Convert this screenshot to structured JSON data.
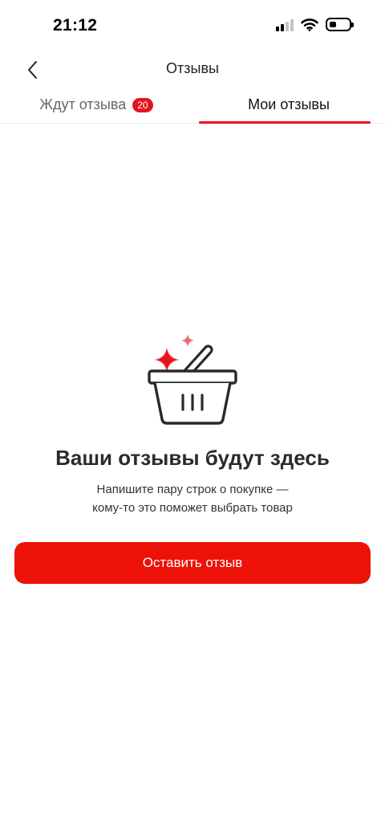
{
  "status_bar": {
    "time": "21:12",
    "icons": [
      "signal-icon",
      "wifi-icon",
      "battery-icon"
    ]
  },
  "header": {
    "title": "Отзывы",
    "back_icon": "chevron-left-icon"
  },
  "tabs": [
    {
      "label": "Ждут отзыва",
      "badge": "20",
      "active": false
    },
    {
      "label": "Мои отзывы",
      "active": true
    }
  ],
  "empty_state": {
    "illustration": "shopping-basket-sparkle-icon",
    "title": "Ваши отзывы будут здесь",
    "subtitle_lines": [
      "Напишите пару строк о покупке —",
      "кому-то это поможет выбрать товар"
    ]
  },
  "primary_button": {
    "label": "Оставить отзыв"
  },
  "colors": {
    "accent": "#ec1208",
    "badge": "#e8141c",
    "text_primary": "#2b2b2b",
    "text_secondary": "#666666"
  }
}
